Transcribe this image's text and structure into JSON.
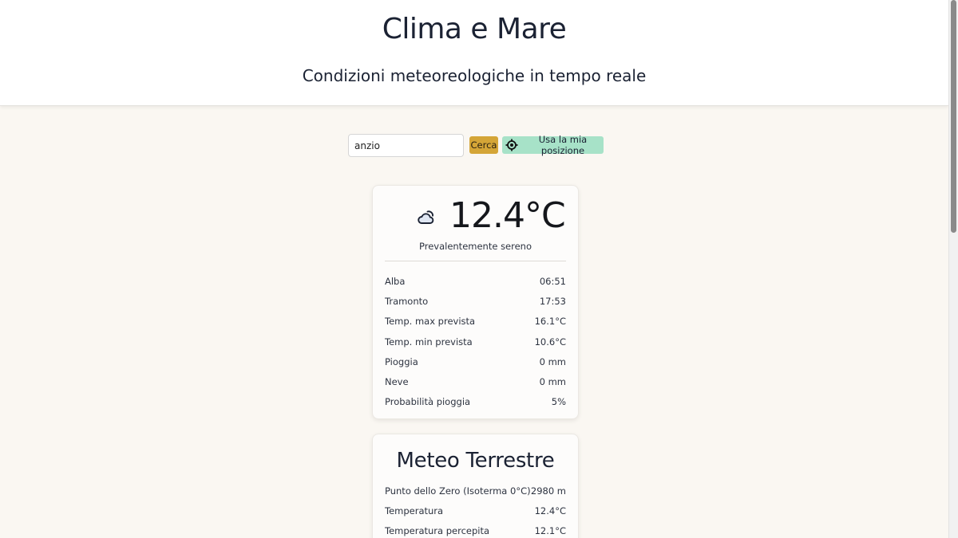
{
  "header": {
    "title": "Clima e Mare",
    "subtitle": "Condizioni meteoreologiche in tempo reale"
  },
  "search": {
    "value": "anzio",
    "button_label": "Cerca",
    "geo_button_label": "Usa la mia posizione",
    "geo_icon": "crosshair-location-icon"
  },
  "current": {
    "icon": "partly-cloudy-icon",
    "temperature": "12.4°C",
    "condition": "Prevalentemente sereno",
    "rows": [
      {
        "label": "Alba",
        "value": "06:51"
      },
      {
        "label": "Tramonto",
        "value": "17:53"
      },
      {
        "label": "Temp. max prevista",
        "value": "16.1°C"
      },
      {
        "label": "Temp. min prevista",
        "value": "10.6°C"
      },
      {
        "label": "Pioggia",
        "value": "0 mm"
      },
      {
        "label": "Neve",
        "value": "0 mm"
      },
      {
        "label": "Probabilità pioggia",
        "value": "5%"
      }
    ]
  },
  "land": {
    "title": "Meteo Terrestre",
    "rows": [
      {
        "label": "Punto dello Zero (Isoterma 0°C)",
        "value": "2980 m"
      },
      {
        "label": "Temperatura",
        "value": "12.4°C"
      },
      {
        "label": "Temperatura percepita",
        "value": "12.1°C"
      }
    ]
  },
  "colors": {
    "page_background": "#faf7f2",
    "search_button": "#d4a537",
    "geo_button": "#a7e2c8",
    "text": "#1b2233"
  }
}
